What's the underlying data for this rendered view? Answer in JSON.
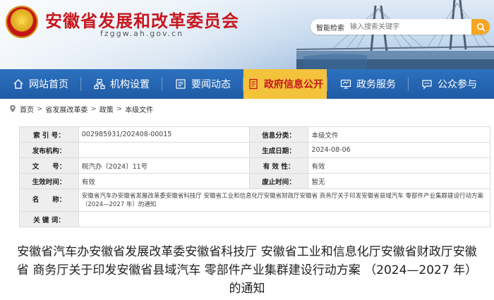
{
  "header": {
    "site_title": "安徽省发展和改革委员会",
    "domain": "fzggw.ah.gov.cn",
    "search_label": "智能检索",
    "search_placeholder": "输入搜索关键字"
  },
  "nav": {
    "items": [
      {
        "label": "网站首页",
        "icon": "home-icon"
      },
      {
        "label": "机构设置",
        "icon": "org-icon"
      },
      {
        "label": "要闻动态",
        "icon": "news-icon"
      },
      {
        "label": "政府信息公开",
        "icon": "docs-icon",
        "active": true
      },
      {
        "label": "政务服务",
        "icon": "service-icon"
      },
      {
        "label": "公众参与",
        "icon": "chat-icon"
      }
    ],
    "active_color": "#f3c33b",
    "bar_color": "#2166b3"
  },
  "breadcrumb": [
    "首页",
    "省发展改革委",
    "政策",
    "本级文件"
  ],
  "info": {
    "index_no_label": "索 引 号：",
    "index_no": "002985931/202408-00015",
    "category_label": "信息分类：",
    "category": "本级文件",
    "issuer_label": "发布机构：",
    "issuer": "",
    "date_label": "生成日期：",
    "date": "2024-08-06",
    "doc_no_label": "文　　号：",
    "doc_no": "皖汽办〔2024〕11号",
    "validity_label": "有 效 性：",
    "validity": "有效",
    "effective_label": "生效时间：",
    "effective": "有效",
    "repeal_label": "废止时间：",
    "repeal": "暂无",
    "name_label": "名　　称：",
    "name": "安徽省汽车办安徽省发展改革委安徽省科技厅 安徽省工业和信息化厅安徽省财政厅安徽省 商务厅关于印发安徽省县域汽车 零部件产业集群建设行动方案 （2024—2027 年）的通知",
    "keywords_label": "关 键 词：",
    "keywords": ""
  },
  "doc_title": "安徽省汽车办安徽省发展改革委安徽省科技厅 安徽省工业和信息化厅安徽省财政厅安徽省 商务厅关于印发安徽省县域汽车 零部件产业集群建设行动方案 （2024—2027 年）的通知"
}
